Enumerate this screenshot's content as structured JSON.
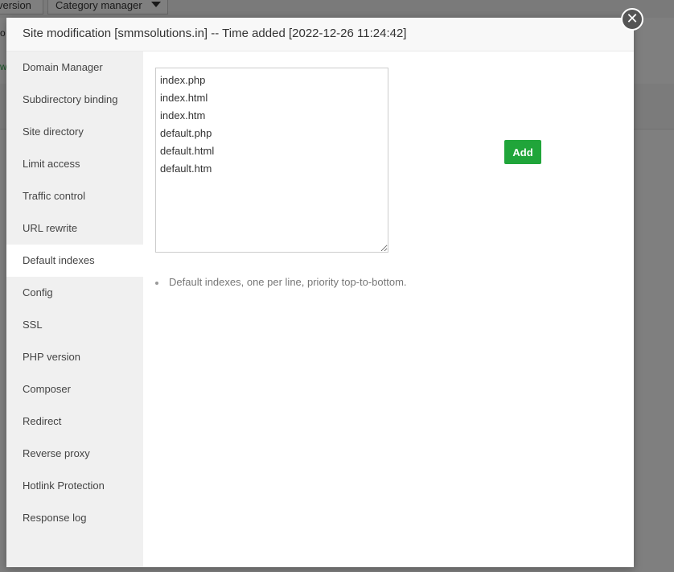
{
  "background": {
    "version_button_label": "version",
    "category_button_label": "Category manager",
    "row1_text": "o",
    "row2_text": "w"
  },
  "modal": {
    "title": "Site modification [smmsolutions.in] -- Time added [2022-12-26 11:24:42]",
    "close_glyph": "✕"
  },
  "sidebar": {
    "items": [
      {
        "label": "Domain Manager"
      },
      {
        "label": "Subdirectory binding"
      },
      {
        "label": "Site directory"
      },
      {
        "label": "Limit access"
      },
      {
        "label": "Traffic control"
      },
      {
        "label": "URL rewrite"
      },
      {
        "label": "Default indexes",
        "active": true
      },
      {
        "label": "Config"
      },
      {
        "label": "SSL"
      },
      {
        "label": "PHP version"
      },
      {
        "label": "Composer"
      },
      {
        "label": "Redirect"
      },
      {
        "label": "Reverse proxy"
      },
      {
        "label": "Hotlink Protection"
      },
      {
        "label": "Response log"
      }
    ]
  },
  "content": {
    "index_files": "index.php\nindex.html\nindex.htm\ndefault.php\ndefault.html\ndefault.htm",
    "add_label": "Add",
    "help_text": "Default indexes, one per line, priority top-to-bottom."
  },
  "colors": {
    "accent_green": "#20a53a",
    "overlay": "rgba(0,0,0,0.5)",
    "sidebar_bg": "#f0f0f0"
  }
}
